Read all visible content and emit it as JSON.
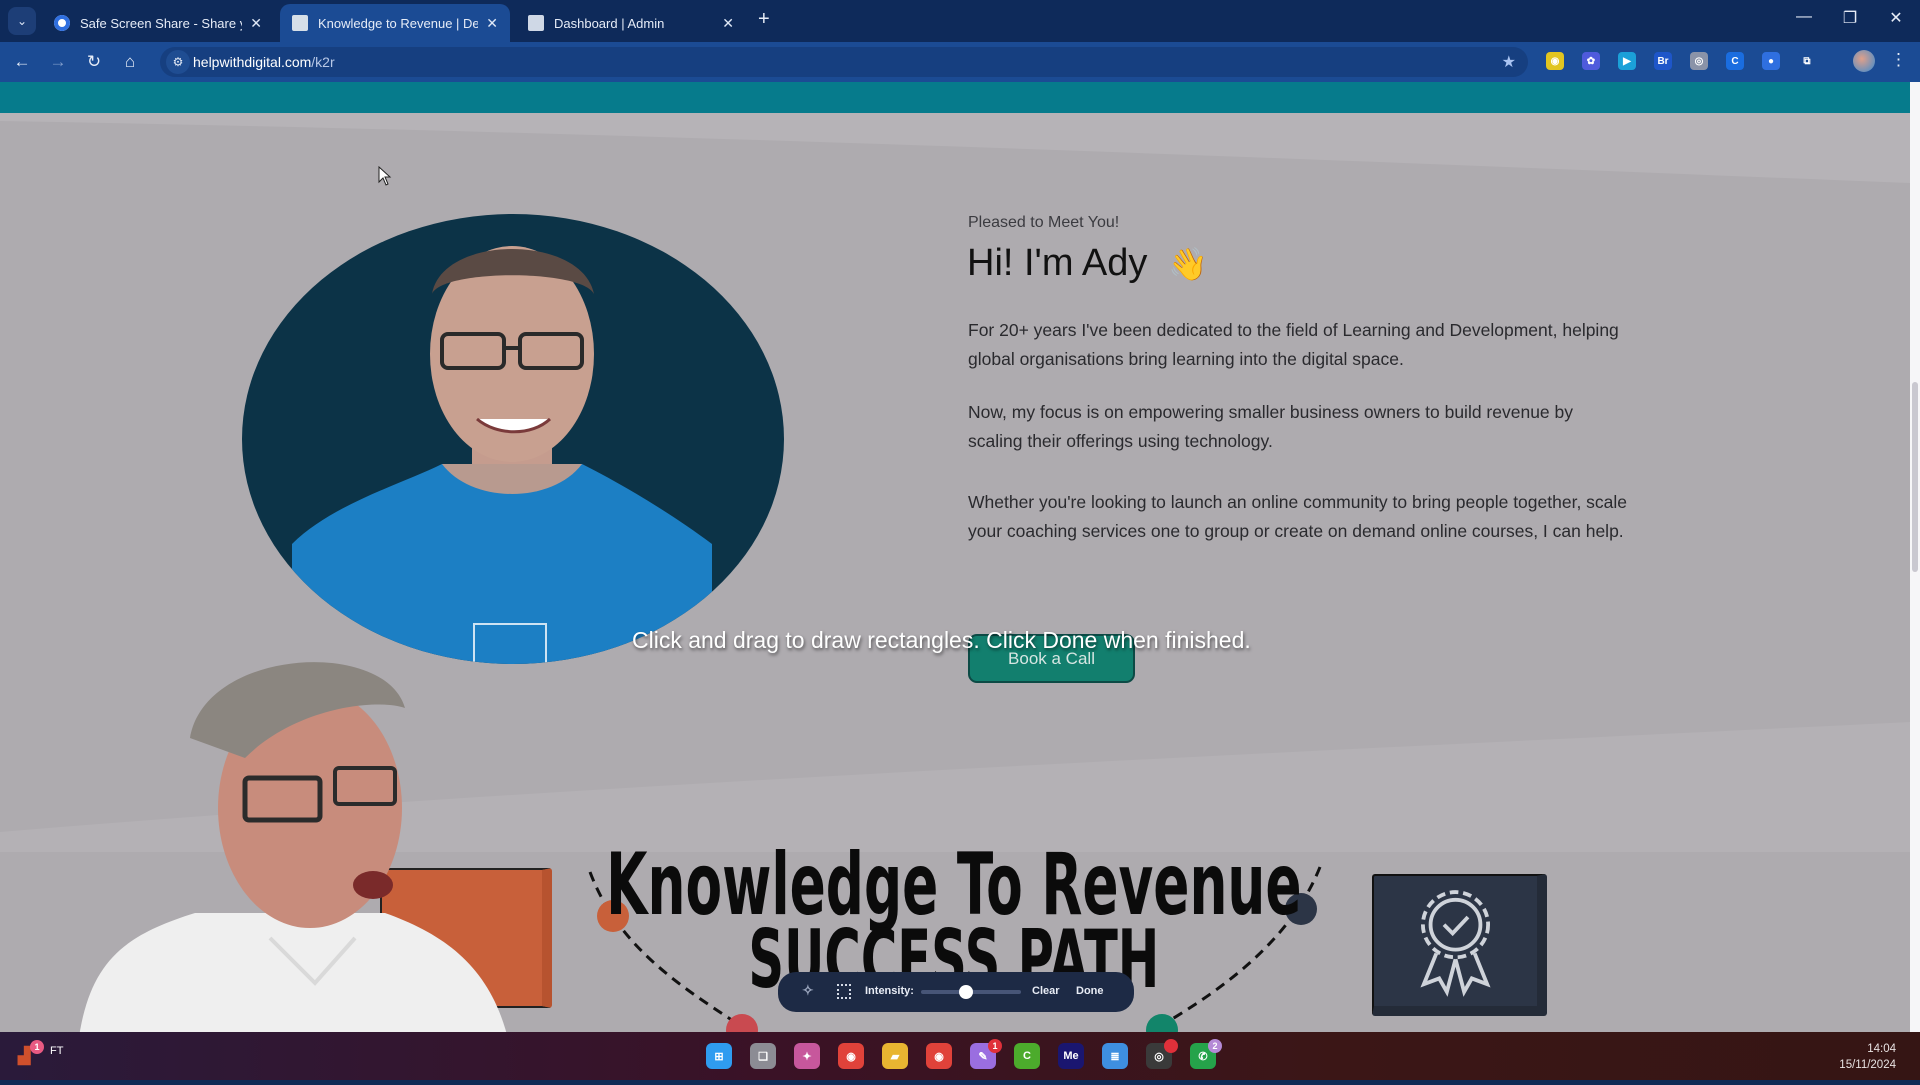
{
  "browser": {
    "tabs": [
      {
        "title": "Safe Screen Share - Share your",
        "favicon": "droplet-icon",
        "active": false
      },
      {
        "title": "Knowledge to Revenue | Design",
        "favicon": "site-icon",
        "active": true
      },
      {
        "title": "Dashboard | Admin",
        "favicon": "monitor-icon",
        "active": false
      }
    ],
    "tab_close_glyph": "✕",
    "new_tab_glyph": "+",
    "tab_search_glyph": "⌄",
    "window_controls": {
      "minimize": "—",
      "restore": "❐",
      "close": "✕"
    },
    "nav": {
      "back": "←",
      "forward": "→",
      "reload": "↻",
      "home": "⌂"
    },
    "url_host": "helpwithdigital.com",
    "url_path": "/k2r",
    "site_info_glyph": "⚙",
    "bookmark_glyph": "★",
    "extensions": [
      {
        "name": "audio-extension-icon",
        "label": "◉",
        "color": "#e1c521"
      },
      {
        "name": "flower-extension-icon",
        "label": "✿",
        "color": "#4f5bdc"
      },
      {
        "name": "play-extension-icon",
        "label": "▶",
        "color": "#1ba0d8"
      },
      {
        "name": "bridge-extension-icon",
        "label": "Br",
        "color": "#1e56c9"
      },
      {
        "name": "camera-extension-icon",
        "label": "◎",
        "color": "#8a93a8"
      },
      {
        "name": "refresh-extension-icon",
        "label": "C",
        "color": "#1a6de0"
      },
      {
        "name": "droplet-extension-icon",
        "label": "●",
        "color": "#2f6fe0"
      },
      {
        "name": "puzzle-extensions-icon",
        "label": "⧉",
        "color": "#1b4b94"
      }
    ],
    "menu_glyph": "⋮"
  },
  "page": {
    "eyebrow": "Pleased to Meet You!",
    "headline": "Hi! I'm Ady",
    "headline_emoji": "👋",
    "paragraphs": [
      "For 20+ years I've been dedicated to the field of Learning and Development, helping global organisations bring learning into the digital space.",
      "Now, my focus is on empowering smaller business owners to build revenue by scaling their offerings using technology.",
      "Whether you're looking to launch an online community to bring people together, scale your coaching services one to group or create on demand online courses, I can help."
    ],
    "cta_label": "Book a Call",
    "success_title_line1": "Knowledge To Revenue",
    "success_title_line2": "SUCCESS PATH",
    "colors": {
      "teal_band": "#067b8c",
      "cta": "#127f6e",
      "portrait_bg": "#0c3347",
      "orange_box": "#c8603a",
      "navy_box": "#2c3546"
    }
  },
  "annotation_tool": {
    "hint": "Click and drag to draw rectangles. Click Done when finished.",
    "intensity_label": "Intensity:",
    "intensity_value": 0.45,
    "clear_label": "Clear",
    "done_label": "Done"
  },
  "taskbar": {
    "apps": [
      {
        "name": "start-icon",
        "label": "⊞",
        "color": "#2f9cf0"
      },
      {
        "name": "task-view-icon",
        "label": "❏",
        "color": "#8c8c94"
      },
      {
        "name": "copilot-icon",
        "label": "✦",
        "color": "#c7579c"
      },
      {
        "name": "chrome-icon",
        "label": "◉",
        "color": "#e0423a"
      },
      {
        "name": "file-explorer-icon",
        "label": "▰",
        "color": "#e8b531"
      },
      {
        "name": "chrome-active-icon",
        "label": "◉",
        "color": "#e0423a"
      },
      {
        "name": "paint-icon",
        "label": "✎",
        "color": "#9a6ee0",
        "badge": "1"
      },
      {
        "name": "camtasia-icon",
        "label": "C",
        "color": "#4cab2c"
      },
      {
        "name": "media-encoder-icon",
        "label": "Me",
        "color": "#1a1670"
      },
      {
        "name": "notepad-icon",
        "label": "≣",
        "color": "#3e8fe0"
      },
      {
        "name": "obs-icon",
        "label": "◎",
        "color": "#3a3a3a",
        "badge": "•"
      },
      {
        "name": "whatsapp-icon",
        "label": "✆",
        "color": "#25a34a",
        "badge": "2"
      }
    ],
    "tray_badge": "1",
    "tray_label": "FT",
    "time": "14:04",
    "date": "15/11/2024"
  }
}
